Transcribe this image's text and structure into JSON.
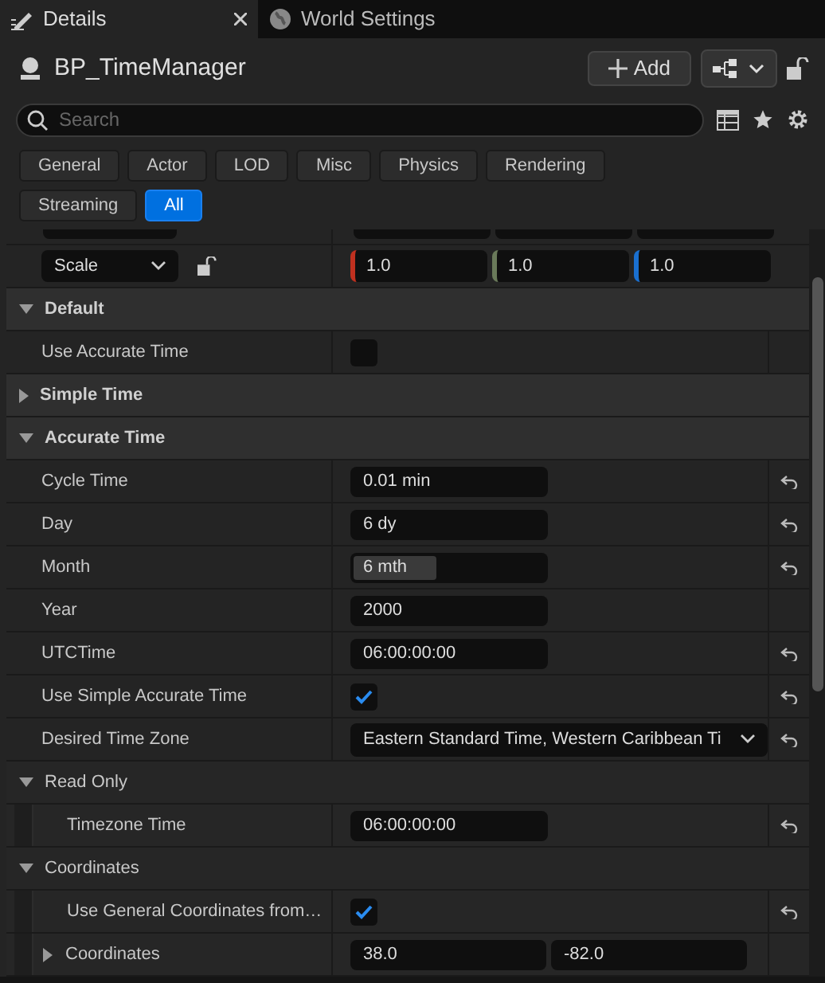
{
  "tabs": [
    {
      "label": "Details",
      "selected": true
    },
    {
      "label": "World Settings",
      "selected": false
    }
  ],
  "header": {
    "title": "BP_TimeManager",
    "add_button": "Add"
  },
  "search": {
    "placeholder": "Search"
  },
  "filters": [
    {
      "label": "General",
      "selected": false
    },
    {
      "label": "Actor",
      "selected": false
    },
    {
      "label": "LOD",
      "selected": false
    },
    {
      "label": "Misc",
      "selected": false
    },
    {
      "label": "Physics",
      "selected": false
    },
    {
      "label": "Rendering",
      "selected": false
    },
    {
      "label": "Streaming",
      "selected": false
    },
    {
      "label": "All",
      "selected": true
    }
  ],
  "scale_row": {
    "mode": "Scale",
    "values": [
      "1.0",
      "1.0",
      "1.0"
    ]
  },
  "sections": [
    {
      "title": "Default",
      "expanded": true,
      "rows": [
        {
          "kind": "checkbox",
          "label": "Use Accurate Time",
          "checked": false,
          "resettable": false
        }
      ]
    },
    {
      "title": "Simple Time",
      "expanded": false
    },
    {
      "title": "Accurate Time",
      "expanded": true,
      "rows": [
        {
          "kind": "text",
          "label": "Cycle Time",
          "value": "0.01 min",
          "resettable": true
        },
        {
          "kind": "text",
          "label": "Day",
          "value": "6 dy",
          "resettable": true
        },
        {
          "kind": "slider",
          "label": "Month",
          "value": "6 mth",
          "level": 0.43,
          "resettable": true
        },
        {
          "kind": "text",
          "label": "Year",
          "value": "2000",
          "resettable": false
        },
        {
          "kind": "text",
          "label": "UTCTime",
          "value": "06:00:00:00",
          "resettable": true
        },
        {
          "kind": "checkbox",
          "label": "Use Simple Accurate Time",
          "checked": true,
          "resettable": true
        },
        {
          "kind": "combo",
          "label": "Desired Time Zone",
          "value": "Eastern Standard Time, Western Caribbean Ti",
          "resettable": true
        },
        {
          "kind": "group",
          "label": "Read Only",
          "expanded": true,
          "children": [
            {
              "kind": "text",
              "label": "Timezone Time",
              "value": "06:00:00:00",
              "resettable": true
            }
          ]
        },
        {
          "kind": "group",
          "label": "Coordinates",
          "expanded": true,
          "children": [
            {
              "kind": "checkbox",
              "label": "Use General Coordinates from…",
              "checked": true,
              "resettable": true
            },
            {
              "kind": "vector2",
              "label": "Coordinates",
              "expanded": false,
              "values": [
                "38.0",
                "-82.0"
              ],
              "resettable": false
            }
          ]
        }
      ]
    }
  ]
}
